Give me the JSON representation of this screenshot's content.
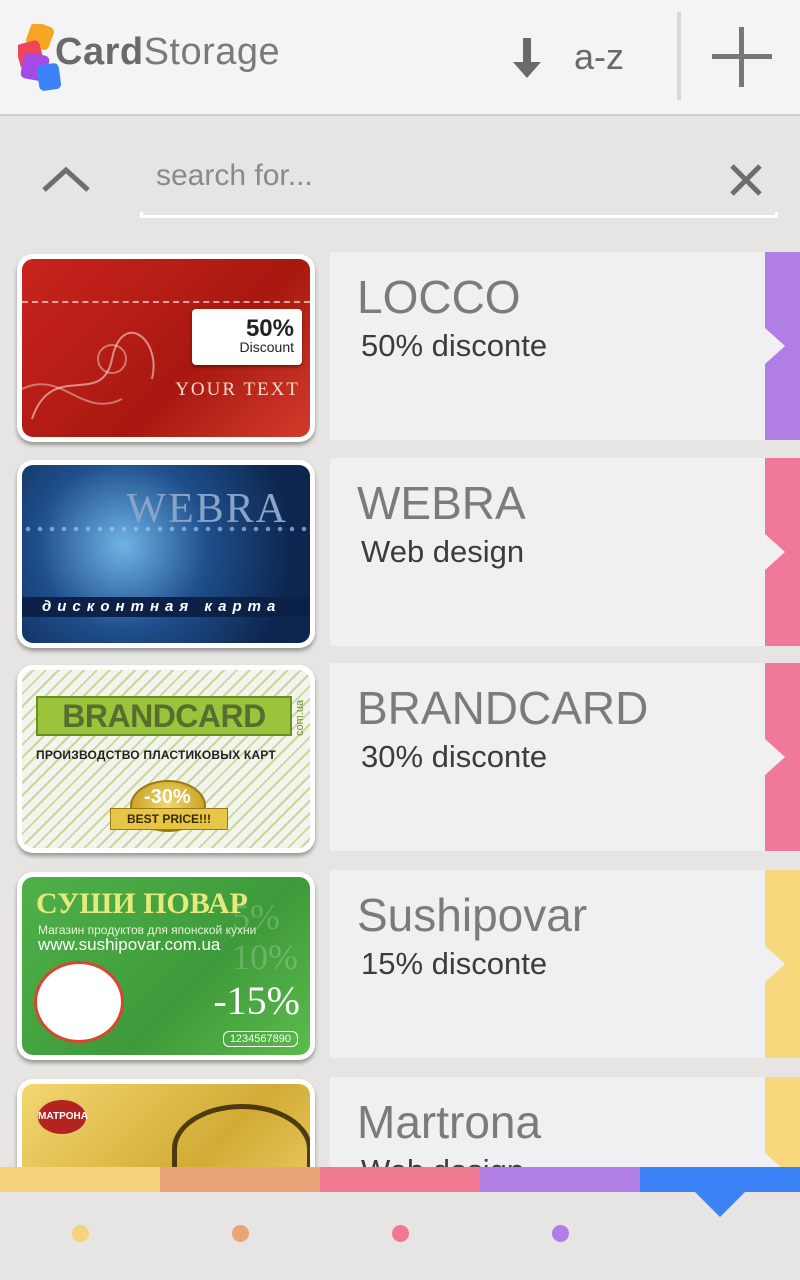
{
  "app": {
    "name_bold": "Card",
    "name_light": "Storage"
  },
  "header": {
    "sort_label": "a-z",
    "sort_icon": "sort-down-arrow-icon",
    "add_icon": "plus-icon"
  },
  "search": {
    "placeholder": "search for...",
    "value": "",
    "collapse_icon": "chevron-up-icon",
    "clear_icon": "close-icon"
  },
  "cards": [
    {
      "title": "LOCCO",
      "subtitle": "50% disconte",
      "tab_color": "#b07ee5",
      "art": {
        "pct": "50%",
        "pct_word": "Discount",
        "footer": "YOUR TEXT"
      }
    },
    {
      "title": "WEBRA",
      "subtitle": "Web design",
      "tab_color": "#f07898",
      "art": {
        "brand": "WEBRA",
        "band": "дисконтная карта"
      }
    },
    {
      "title": "BRANDCARD",
      "subtitle": "30% disconte",
      "tab_color": "#f07898",
      "art": {
        "brand": "BRANDCARD",
        "domain": "com.ua",
        "sub": "ПРОИЗВОДСТВО ПЛАСТИКОВЫХ КАРТ",
        "pct": "-30%",
        "ribbon": "BEST PRICE!!!"
      }
    },
    {
      "title": "Sushipovar",
      "subtitle": "15% disconte",
      "tab_color": "#f8d87c",
      "art": {
        "brand": "СУШИ ПОВАР",
        "line1": "Магазин продуктов для японской кухни",
        "line2": "www.sushipovar.com.ua",
        "ghost": "5%\n10%",
        "pct": "-15%",
        "number": "1234567890"
      }
    },
    {
      "title": "Martrona",
      "subtitle": "Web design",
      "tab_color": "#f8d87c",
      "art": {
        "brand": "МАТРОНА"
      }
    }
  ],
  "bottom": {
    "colors": [
      "#f6d27a",
      "#eaa478",
      "#f07890",
      "#b07ee5",
      "#3b82f6"
    ],
    "dot_colors": [
      "#f6d27a",
      "#eaa478",
      "#f07890",
      "#b07ee5"
    ],
    "active_index": 4
  }
}
